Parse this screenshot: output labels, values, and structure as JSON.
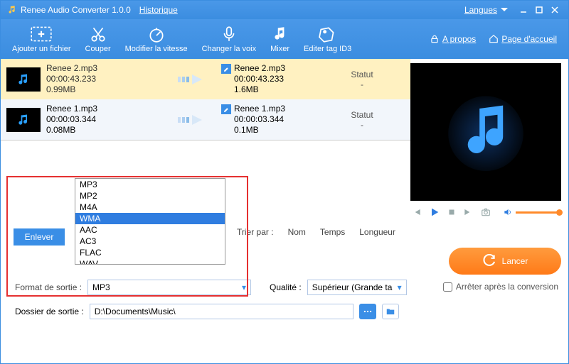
{
  "title": "Renee Audio Converter 1.0.0",
  "titlebar": {
    "history": "Historique",
    "lang": "Langues"
  },
  "toolbar": {
    "add": "Ajouter un fichier",
    "cut": "Couper",
    "speed": "Modifier la vitesse",
    "voice": "Changer la voix",
    "mixer": "Mixer",
    "id3": "Editer tag ID3",
    "about": "A propos",
    "home": "Page d'accueil"
  },
  "rows": [
    {
      "src_name": "Renee 2.mp3",
      "src_dur": "00:00:43.233",
      "src_size": "0.99MB",
      "dst_name": "Renee 2.mp3",
      "dst_dur": "00:00:43.233",
      "dst_size": "1.6MB",
      "status_label": "Statut",
      "status_val": "-"
    },
    {
      "src_name": "Renee 1.mp3",
      "src_dur": "00:00:03.344",
      "src_size": "0.08MB",
      "dst_name": "Renee 1.mp3",
      "dst_dur": "00:00:03.344",
      "dst_size": "0.1MB",
      "status_label": "Statut",
      "status_val": "-"
    }
  ],
  "remove": "Enlever",
  "formats": [
    "MP3",
    "MP2",
    "M4A",
    "WMA",
    "AAC",
    "AC3",
    "FLAC",
    "WAV"
  ],
  "format_selected_index": 3,
  "sort": {
    "label": "Trier par :",
    "name": "Nom",
    "time": "Temps",
    "length": "Longueur"
  },
  "format_label": "Format de sortie :",
  "format_value": "MP3",
  "quality_label": "Qualité :",
  "quality_value": "Supérieur (Grande ta",
  "folder_label": "Dossier de sortie :",
  "folder_value": "D:\\Documents\\Music\\",
  "launch": "Lancer",
  "stop_after": "Arrêter après la conversion"
}
